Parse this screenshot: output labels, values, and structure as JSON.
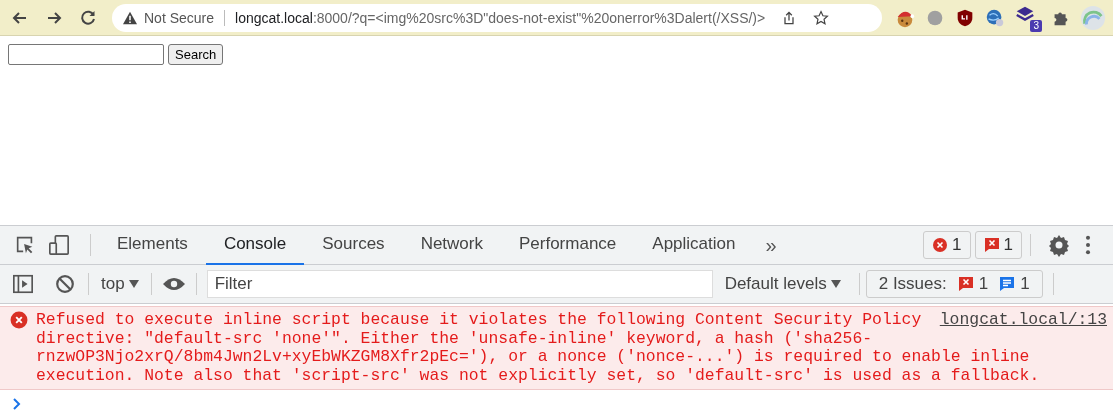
{
  "browser": {
    "address_bar": {
      "security_label": "Not Secure",
      "host": "longcat.local",
      "rest": ":8000/?q=<img%20src%3D\"does-not-exist\"%20onerror%3Dalert(/XSS/)>"
    },
    "extensions": [
      {
        "kind": "cookie"
      },
      {
        "kind": "circle"
      },
      {
        "kind": "shield"
      },
      {
        "kind": "globe"
      },
      {
        "kind": "stack",
        "badge": "3"
      },
      {
        "kind": "puzzle"
      },
      {
        "kind": "avatar"
      }
    ]
  },
  "page": {
    "search_button": "Search"
  },
  "devtools": {
    "tabs": [
      {
        "label": "Elements",
        "selected": false
      },
      {
        "label": "Console",
        "selected": true
      },
      {
        "label": "Sources",
        "selected": false
      },
      {
        "label": "Network",
        "selected": false
      },
      {
        "label": "Performance",
        "selected": false
      },
      {
        "label": "Application",
        "selected": false
      }
    ],
    "more_tabs": "»",
    "error_count": "1",
    "issue_count": "1",
    "context": "top",
    "filter": {
      "placeholder": "Filter"
    },
    "levels": "Default levels",
    "issues": {
      "label": "2 Issues:",
      "errors": "1",
      "infos": "1"
    },
    "messages": [
      {
        "kind": "error",
        "source": "longcat.local/:13",
        "lines": [
          "Refused to execute inline script because it violates the following Content Security Policy",
          "directive: \"default-src 'none'\". Either the 'unsafe-inline' keyword, a hash ('sha256-",
          "rnzwOP3Njo2xrQ/8bm4Jwn2Lv+xyEbWKZGM8Xfr2pEc='), or a nonce ('nonce-...') is required to enable inline",
          "execution. Note also that 'script-src' was not explicitly set, so 'default-src' is used as a fallback."
        ]
      }
    ]
  }
}
